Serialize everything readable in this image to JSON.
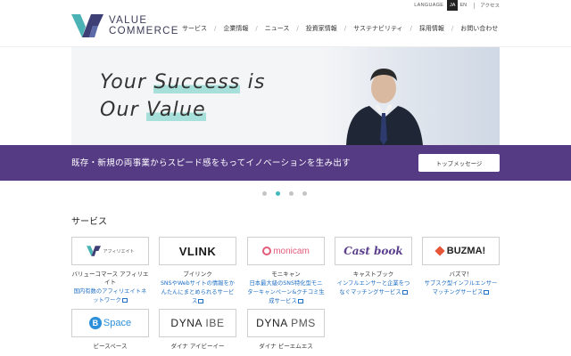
{
  "header": {
    "logo_line1": "VALUE",
    "logo_line2": "COMMERCE",
    "language_label": "LANGUAGE",
    "lang_ja": "JA",
    "lang_en": "EN",
    "access": "アクセス",
    "nav": [
      "サービス",
      "企業情報",
      "ニュース",
      "投資家情報",
      "サステナビリティ",
      "採用情報",
      "お問い合わせ"
    ]
  },
  "hero": {
    "line1_a": "Your ",
    "line1_hl": "Success",
    "line1_b": " is",
    "line2_a": "Our  ",
    "line2_hl": "Value"
  },
  "banner": {
    "text": "既存・新規の両事業からスピード感をもってイノベーションを生み出す",
    "button": "トップメッセージ"
  },
  "carousel": {
    "count": 4,
    "active_index": 1
  },
  "services": {
    "title": "サービス",
    "items": [
      {
        "logo": "アフィリエイト",
        "name": "バリューコマース アフィリエイト",
        "desc": "国内有数のアフィリエイトネットワーク"
      },
      {
        "logo": "VLINK",
        "name": "ブイリンク",
        "desc": "SNSやWebサイトの情報をかんたんにまとめられるサービス"
      },
      {
        "logo": "monicam",
        "name": "モニキャン",
        "desc": "日本最大級のSNS特化型モニターキャンペーン&クチコミ生成サービス"
      },
      {
        "logo": "Cast book",
        "name": "キャストブック",
        "desc": "インフルエンサーと企業をつなぐマッチングサービス"
      },
      {
        "logo": "BUZMA!",
        "name": "バズマ！",
        "desc": "サブスク型インフルエンサーマッチングサービス"
      },
      {
        "logo": "Space",
        "logo_b": "B",
        "name": "ビースペース",
        "desc": ""
      },
      {
        "logo_a": "DYNA",
        "logo_b": " IBE",
        "name": "ダイナ アイビーイー",
        "desc": ""
      },
      {
        "logo_a": "DYNA",
        "logo_b": " PMS",
        "name": "ダイナ ピーエムエス",
        "desc": ""
      }
    ]
  },
  "colors": {
    "brand_purple": "#553a84",
    "accent_teal": "#40b9bd",
    "link_blue": "#1f6fc4"
  }
}
